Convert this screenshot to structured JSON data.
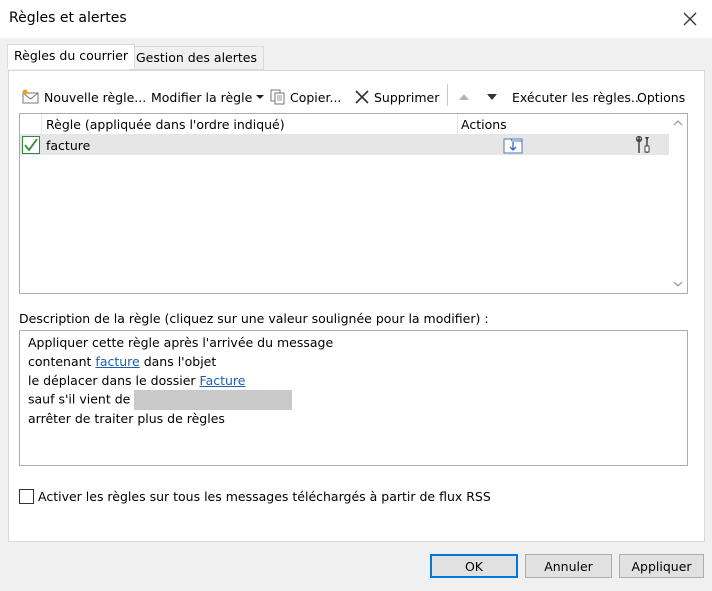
{
  "window": {
    "title": "Règles et alertes"
  },
  "tabs": [
    {
      "label": "Règles du courrier"
    },
    {
      "label": "Gestion des alertes"
    }
  ],
  "toolbar": {
    "new_rule": "Nouvelle règle...",
    "modify_rule": "Modifier la règle",
    "copy": "Copier...",
    "delete": "Supprimer",
    "run_rules": "Exécuter les règles...",
    "options": "Options"
  },
  "rules_table": {
    "columns": [
      "Règle (appliquée dans l'ordre indiqué)",
      "Actions"
    ],
    "rows": [
      {
        "name": "facture",
        "enabled": true
      }
    ]
  },
  "description": {
    "label": "Description de la règle (cliquez sur une valeur soulignée pour la modifier) :",
    "lines": {
      "l1": "Appliquer cette règle après l'arrivée du message",
      "l2_prefix": "contenant ",
      "l2_link": "facture",
      "l2_suffix": " dans l'objet",
      "l3_prefix": "le déplacer dans le dossier ",
      "l3_link": "Facture",
      "l4_prefix": "sauf s'il vient de",
      "l5": "arrêter de traiter plus de règles"
    }
  },
  "rss_option": {
    "label": "Activer les règles sur tous les messages téléchargés à partir de flux RSS",
    "checked": false
  },
  "buttons": {
    "ok": "OK",
    "cancel": "Annuler",
    "apply": "Appliquer"
  },
  "colors": {
    "accent": "#0078d7",
    "link": "#1a5fb4",
    "check": "#2e8b3a"
  }
}
